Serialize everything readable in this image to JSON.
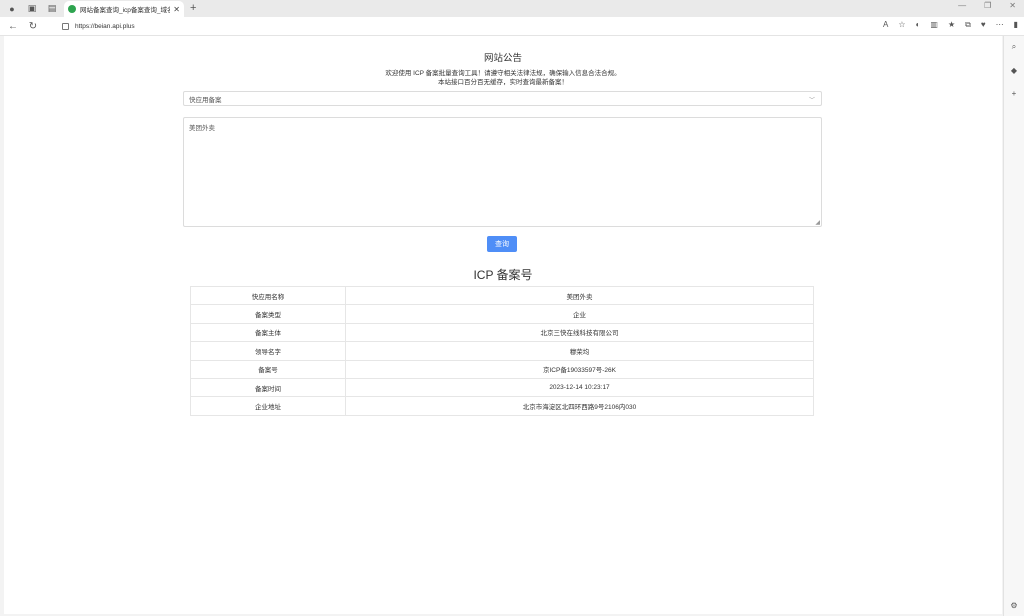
{
  "browser": {
    "tab_title": "网站备案查询_icp备案查询_域名备案",
    "url": "https://beian.api.plus"
  },
  "notice": {
    "title": "网站公告",
    "line1": "欢迎使用 ICP 备案批量查询工具！请遵守相关法律法规，确保输入信息合法合规。",
    "line2": "本站接口百分百无缓存，实时查询最新备案！"
  },
  "form": {
    "select_value": "快应用备案",
    "textarea_value": "美团外卖",
    "query_label": "查询"
  },
  "result": {
    "title": "ICP 备案号",
    "rows": [
      {
        "key": "快应用名称",
        "value": "美团外卖"
      },
      {
        "key": "备案类型",
        "value": "企业"
      },
      {
        "key": "备案主体",
        "value": "北京三快在线科技有限公司"
      },
      {
        "key": "领导名字",
        "value": "穆荣均"
      },
      {
        "key": "备案号",
        "value": "京ICP备19033597号-26K"
      },
      {
        "key": "备案时间",
        "value": "2023-12-14 10:23:17"
      },
      {
        "key": "企业地址",
        "value": "北京市海淀区北四环西路9号2106内030"
      }
    ]
  },
  "colors": {
    "accent": "#4f8ef7",
    "favicon": "#2ea44f"
  }
}
